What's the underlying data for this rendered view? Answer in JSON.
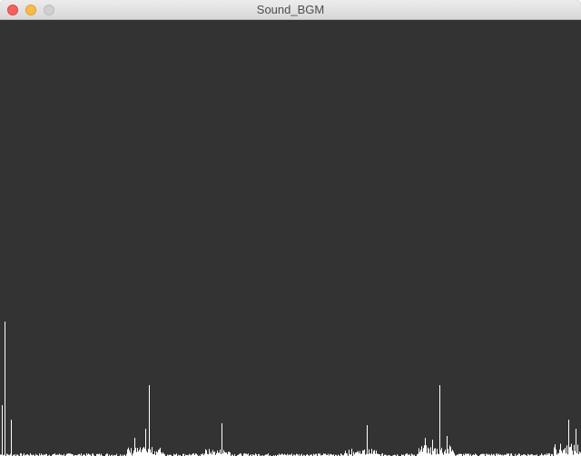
{
  "window": {
    "title": "Sound_BGM"
  },
  "colors": {
    "canvas_background": "#333333",
    "bar_color": "#ffffff",
    "close_button": "#fc605c",
    "minimize_button": "#fdbc40",
    "zoom_button": "#d0d0d0"
  },
  "chart_data": {
    "type": "bar",
    "ylim": [
      0,
      480
    ],
    "peaks": [
      {
        "bin": 5,
        "value": 148
      },
      {
        "bin": 2,
        "value": 56
      },
      {
        "bin": 12,
        "value": 40
      },
      {
        "bin": 164,
        "value": 78
      },
      {
        "bin": 160,
        "value": 30
      },
      {
        "bin": 148,
        "value": 20
      },
      {
        "bin": 244,
        "value": 36
      },
      {
        "bin": 404,
        "value": 34
      },
      {
        "bin": 484,
        "value": 78
      },
      {
        "bin": 468,
        "value": 20
      },
      {
        "bin": 476,
        "value": 18
      },
      {
        "bin": 492,
        "value": 22
      },
      {
        "bin": 626,
        "value": 40
      },
      {
        "bin": 634,
        "value": 30
      }
    ],
    "clusters": [
      {
        "start": 140,
        "end": 180,
        "level": 10
      },
      {
        "start": 225,
        "end": 255,
        "level": 8
      },
      {
        "start": 380,
        "end": 415,
        "level": 8
      },
      {
        "start": 460,
        "end": 500,
        "level": 12
      },
      {
        "start": 610,
        "end": 640,
        "level": 14
      }
    ],
    "baseline_level": 3
  }
}
